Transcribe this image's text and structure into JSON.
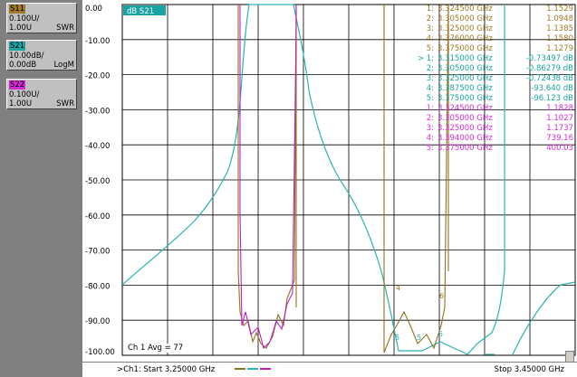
{
  "traces": [
    {
      "tag": "S11",
      "line2": "0.100U/",
      "line3": "1.00U",
      "format": "SWR",
      "color": "#a07a28"
    },
    {
      "tag": "S21",
      "line2": "10.00dB/",
      "line3": "0.00dB",
      "format": "LogM",
      "color": "#1aa3a3"
    },
    {
      "tag": "S22",
      "line2": "0.100U/",
      "line3": "1.00U",
      "format": "SWR",
      "color": "#d42ad4"
    }
  ],
  "active_trace_label": "dB S21",
  "y_axis_labels": [
    "0.00",
    "-10.00",
    "-20.00",
    "-30.00",
    "-40.00",
    "-50.00",
    "-60.00",
    "-70.00",
    "-80.00",
    "-90.00",
    "-100.00"
  ],
  "markers": [
    {
      "num": "1:",
      "freq": "3.324500 GHz",
      "val": "1.1529",
      "color": "#a07a28"
    },
    {
      "num": "2:",
      "freq": "3.305000 GHz",
      "val": "1.0948",
      "color": "#a07a28"
    },
    {
      "num": "3:",
      "freq": "3.325000 GHz",
      "val": "1.1385",
      "color": "#a07a28"
    },
    {
      "num": "4:",
      "freq": "3.376000 GHz",
      "val": "1.1580",
      "color": "#a07a28"
    },
    {
      "num": "5:",
      "freq": "3.375000 GHz",
      "val": "1.1279",
      "color": "#a07a28"
    },
    {
      "num": "> 1:",
      "freq": "3.315000 GHz",
      "val": "-0.73497 dB",
      "color": "#1aa3a3"
    },
    {
      "num": "2:",
      "freq": "3.305000 GHz",
      "val": "-0.86279 dB",
      "color": "#1aa3a3"
    },
    {
      "num": "3:",
      "freq": "3.325000 GHz",
      "val": "-0.72438 dB",
      "color": "#1aa3a3"
    },
    {
      "num": "4:",
      "freq": "3.387500 GHz",
      "val": "-93.640 dB",
      "color": "#1aa3a3"
    },
    {
      "num": "5:",
      "freq": "3.375000 GHz",
      "val": "-96.123 dB",
      "color": "#1aa3a3"
    },
    {
      "num": "1:",
      "freq": "3.324500 GHz",
      "val": "1.1828",
      "color": "#d42ad4"
    },
    {
      "num": "2:",
      "freq": "3.305000 GHz",
      "val": "1.1027",
      "color": "#d42ad4"
    },
    {
      "num": "3:",
      "freq": "3.325000 GHz",
      "val": "1.1737",
      "color": "#d42ad4"
    },
    {
      "num": "4:",
      "freq": "3.394000 GHz",
      "val": "739.16",
      "color": "#d42ad4"
    },
    {
      "num": "5:",
      "freq": "3.375000 GHz",
      "val": "400.03",
      "color": "#d42ad4"
    }
  ],
  "ch_avg": "Ch 1 Avg =    77",
  "start": ">Ch1: Start  3.25000 GHz",
  "stop": "Stop  3.45000 GHz",
  "marker_flags": [
    "4",
    "6",
    "5",
    "5",
    "5"
  ]
}
